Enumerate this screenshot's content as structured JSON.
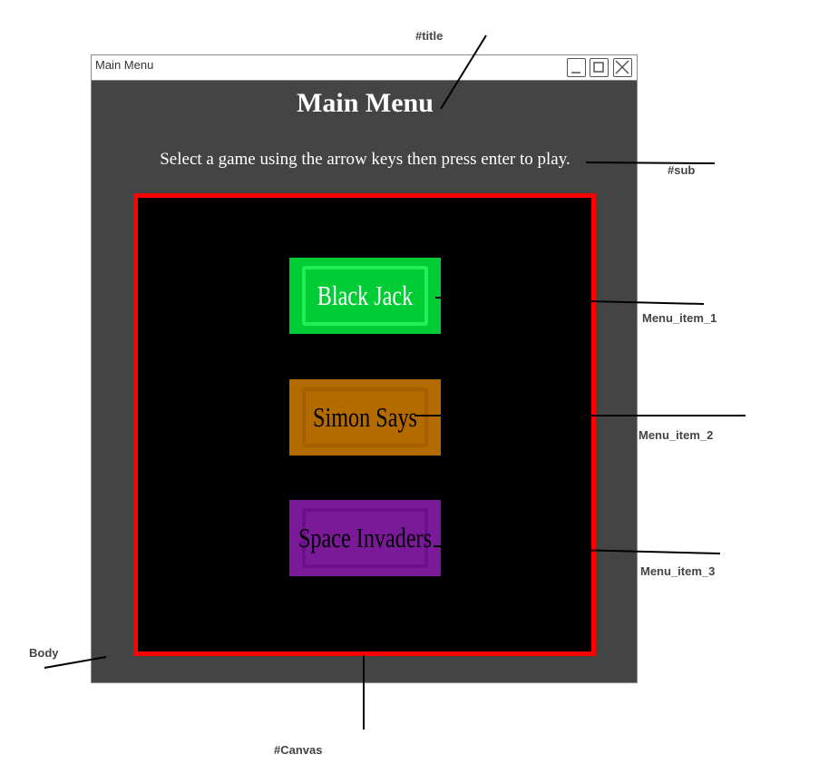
{
  "window": {
    "title": "Main Menu",
    "controls": [
      "minimize-icon",
      "maximize-icon",
      "close-icon"
    ]
  },
  "page": {
    "title": "Main Menu",
    "subtitle": "Select a game using the arrow keys then press enter to play."
  },
  "menu": {
    "items": [
      {
        "label": "Black Jack",
        "color": "#00cc33",
        "inner_border": "#22ee55",
        "text_color": "#ffffff",
        "selected": true
      },
      {
        "label": "Simon Says",
        "color": "#b36b00",
        "inner_border": "#a45f00",
        "text_color": "#000000",
        "selected": false
      },
      {
        "label": "Space Invaders",
        "color": "#7a1a99",
        "inner_border": "#6c0f8a",
        "text_color": "#000000",
        "selected": false
      }
    ]
  },
  "annotations": {
    "title": "#title",
    "sub": "#sub",
    "menu_item_1": "Menu_item_1",
    "menu_item_2": "Menu_item_2",
    "menu_item_3": "Menu_item_3",
    "body": "Body",
    "canvas": "#Canvas"
  },
  "colors": {
    "window_bg": "#444444",
    "canvas_bg": "#000000",
    "canvas_border": "#ff0000",
    "text": "#ffffff"
  }
}
